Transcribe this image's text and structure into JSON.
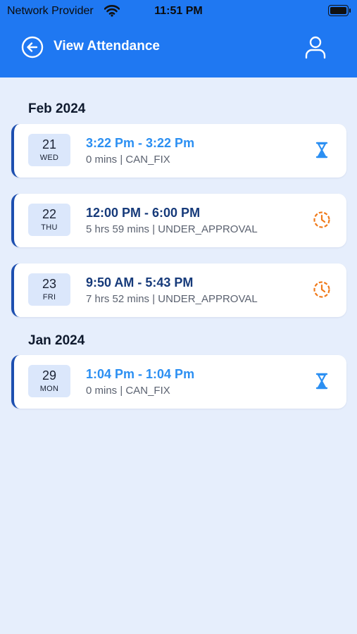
{
  "status_bar": {
    "carrier": "Network Provider",
    "time": "11:51 PM"
  },
  "header": {
    "title": "View Attendance",
    "back_icon": "arrow-left-circle-icon",
    "profile_icon": "user-icon"
  },
  "colors": {
    "primary": "#1f78f2",
    "background": "#e6eefc",
    "accent_blue": "#2b8ff2",
    "dark_blue": "#163a7a",
    "pending_orange": "#f07a1a"
  },
  "groups": [
    {
      "month": "Feb 2024",
      "entries": [
        {
          "day": "21",
          "weekday": "WED",
          "time_range": "3:22 Pm - 3:22 Pm",
          "details": "0 mins | CAN_FIX",
          "status_icon": "hourglass-icon"
        },
        {
          "day": "22",
          "weekday": "THU",
          "time_range": "12:00 PM - 6:00 PM",
          "details": "5 hrs 59 mins | UNDER_APPROVAL",
          "status_icon": "clock-pending-icon"
        },
        {
          "day": "23",
          "weekday": "FRI",
          "time_range": "9:50 AM - 5:43 PM",
          "details": "7 hrs 52 mins | UNDER_APPROVAL",
          "status_icon": "clock-pending-icon"
        }
      ]
    },
    {
      "month": "Jan 2024",
      "entries": [
        {
          "day": "29",
          "weekday": "MON",
          "time_range": "1:04 Pm - 1:04 Pm",
          "details": "0 mins | CAN_FIX",
          "status_icon": "hourglass-icon"
        }
      ]
    }
  ]
}
